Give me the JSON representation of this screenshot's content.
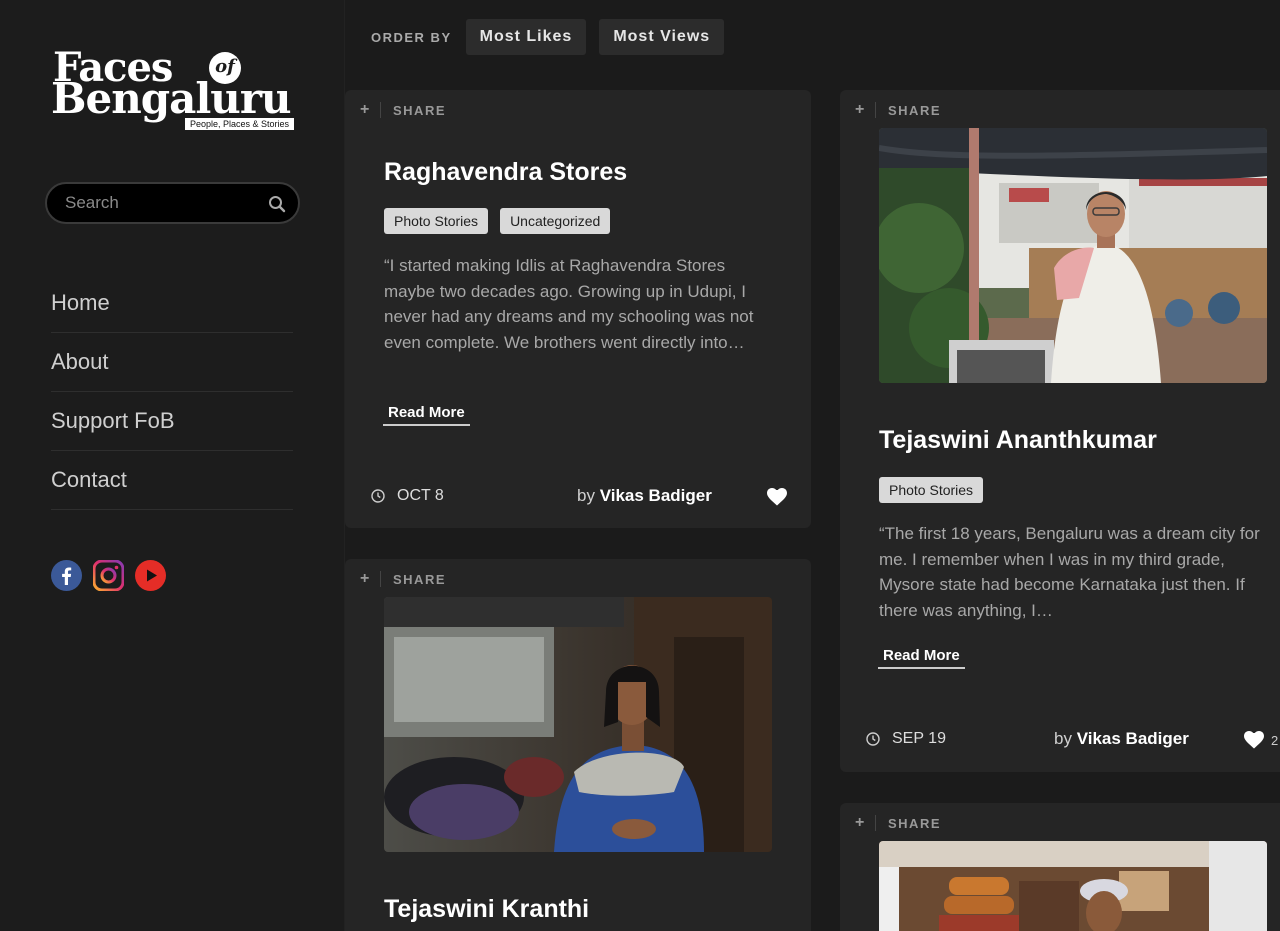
{
  "sidebar": {
    "logo": {
      "line1": "Faces",
      "of": "of",
      "line2": "Bengaluru",
      "tagline": "People, Places & Stories"
    },
    "search": {
      "placeholder": "Search"
    },
    "nav": [
      "Home",
      "About",
      "Support FoB",
      "Contact"
    ],
    "social": [
      "facebook-icon",
      "instagram-icon",
      "youtube-icon"
    ]
  },
  "order": {
    "label": "ORDER BY",
    "buttons": [
      "Most Likes",
      "Most Views"
    ]
  },
  "share_label": "SHARE",
  "posts": [
    {
      "title": "Raghavendra Stores",
      "tags": [
        "Photo Stories",
        "Uncategorized"
      ],
      "excerpt": "“I started making Idlis at Raghavendra Stores maybe two decades ago. Growing up in Udupi, I never had any dreams and my schooling was not even complete. We brothers went directly into…",
      "read_more": "Read More",
      "date": "OCT 8",
      "by": "by",
      "author": "Vikas Badiger"
    },
    {
      "title": "Tejaswini Ananthkumar",
      "tags": [
        "Photo Stories"
      ],
      "excerpt": "“The first 18 years, Bengaluru was a dream city for me. I remember when I was in my third grade, Mysore state had become Karnataka just then. If there was anything, I…",
      "read_more": "Read More",
      "date": "SEP 19",
      "by": "by",
      "author": "Vikas Badiger",
      "likes": "2"
    },
    {
      "title": "Tejaswini Kranthi"
    }
  ],
  "colors": {
    "background": "#1b1b1b",
    "card": "#252525",
    "accent_red": "#e52d27",
    "facebook_blue": "#3b5998"
  }
}
